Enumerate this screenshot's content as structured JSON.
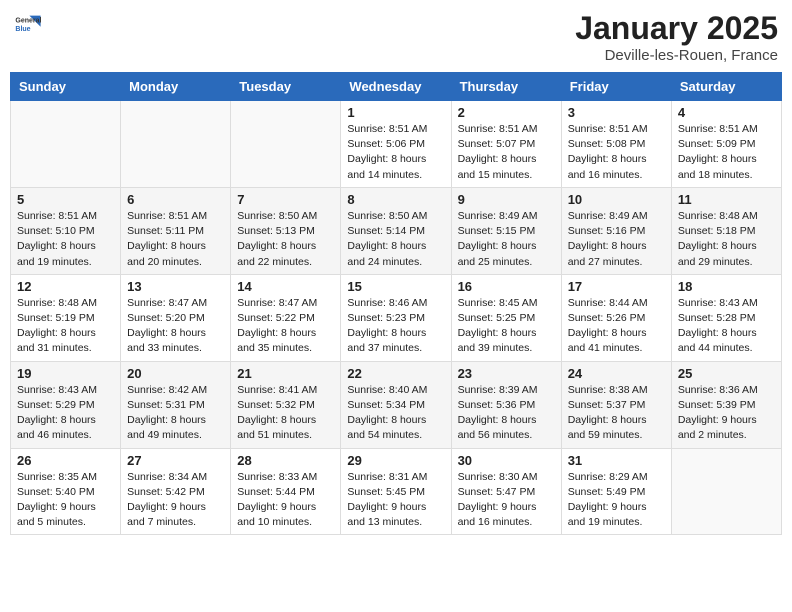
{
  "header": {
    "logo_general": "General",
    "logo_blue": "Blue",
    "month": "January 2025",
    "location": "Deville-les-Rouen, France"
  },
  "weekdays": [
    "Sunday",
    "Monday",
    "Tuesday",
    "Wednesday",
    "Thursday",
    "Friday",
    "Saturday"
  ],
  "weeks": [
    [
      {
        "day": "",
        "info": ""
      },
      {
        "day": "",
        "info": ""
      },
      {
        "day": "",
        "info": ""
      },
      {
        "day": "1",
        "info": "Sunrise: 8:51 AM\nSunset: 5:06 PM\nDaylight: 8 hours\nand 14 minutes."
      },
      {
        "day": "2",
        "info": "Sunrise: 8:51 AM\nSunset: 5:07 PM\nDaylight: 8 hours\nand 15 minutes."
      },
      {
        "day": "3",
        "info": "Sunrise: 8:51 AM\nSunset: 5:08 PM\nDaylight: 8 hours\nand 16 minutes."
      },
      {
        "day": "4",
        "info": "Sunrise: 8:51 AM\nSunset: 5:09 PM\nDaylight: 8 hours\nand 18 minutes."
      }
    ],
    [
      {
        "day": "5",
        "info": "Sunrise: 8:51 AM\nSunset: 5:10 PM\nDaylight: 8 hours\nand 19 minutes."
      },
      {
        "day": "6",
        "info": "Sunrise: 8:51 AM\nSunset: 5:11 PM\nDaylight: 8 hours\nand 20 minutes."
      },
      {
        "day": "7",
        "info": "Sunrise: 8:50 AM\nSunset: 5:13 PM\nDaylight: 8 hours\nand 22 minutes."
      },
      {
        "day": "8",
        "info": "Sunrise: 8:50 AM\nSunset: 5:14 PM\nDaylight: 8 hours\nand 24 minutes."
      },
      {
        "day": "9",
        "info": "Sunrise: 8:49 AM\nSunset: 5:15 PM\nDaylight: 8 hours\nand 25 minutes."
      },
      {
        "day": "10",
        "info": "Sunrise: 8:49 AM\nSunset: 5:16 PM\nDaylight: 8 hours\nand 27 minutes."
      },
      {
        "day": "11",
        "info": "Sunrise: 8:48 AM\nSunset: 5:18 PM\nDaylight: 8 hours\nand 29 minutes."
      }
    ],
    [
      {
        "day": "12",
        "info": "Sunrise: 8:48 AM\nSunset: 5:19 PM\nDaylight: 8 hours\nand 31 minutes."
      },
      {
        "day": "13",
        "info": "Sunrise: 8:47 AM\nSunset: 5:20 PM\nDaylight: 8 hours\nand 33 minutes."
      },
      {
        "day": "14",
        "info": "Sunrise: 8:47 AM\nSunset: 5:22 PM\nDaylight: 8 hours\nand 35 minutes."
      },
      {
        "day": "15",
        "info": "Sunrise: 8:46 AM\nSunset: 5:23 PM\nDaylight: 8 hours\nand 37 minutes."
      },
      {
        "day": "16",
        "info": "Sunrise: 8:45 AM\nSunset: 5:25 PM\nDaylight: 8 hours\nand 39 minutes."
      },
      {
        "day": "17",
        "info": "Sunrise: 8:44 AM\nSunset: 5:26 PM\nDaylight: 8 hours\nand 41 minutes."
      },
      {
        "day": "18",
        "info": "Sunrise: 8:43 AM\nSunset: 5:28 PM\nDaylight: 8 hours\nand 44 minutes."
      }
    ],
    [
      {
        "day": "19",
        "info": "Sunrise: 8:43 AM\nSunset: 5:29 PM\nDaylight: 8 hours\nand 46 minutes."
      },
      {
        "day": "20",
        "info": "Sunrise: 8:42 AM\nSunset: 5:31 PM\nDaylight: 8 hours\nand 49 minutes."
      },
      {
        "day": "21",
        "info": "Sunrise: 8:41 AM\nSunset: 5:32 PM\nDaylight: 8 hours\nand 51 minutes."
      },
      {
        "day": "22",
        "info": "Sunrise: 8:40 AM\nSunset: 5:34 PM\nDaylight: 8 hours\nand 54 minutes."
      },
      {
        "day": "23",
        "info": "Sunrise: 8:39 AM\nSunset: 5:36 PM\nDaylight: 8 hours\nand 56 minutes."
      },
      {
        "day": "24",
        "info": "Sunrise: 8:38 AM\nSunset: 5:37 PM\nDaylight: 8 hours\nand 59 minutes."
      },
      {
        "day": "25",
        "info": "Sunrise: 8:36 AM\nSunset: 5:39 PM\nDaylight: 9 hours\nand 2 minutes."
      }
    ],
    [
      {
        "day": "26",
        "info": "Sunrise: 8:35 AM\nSunset: 5:40 PM\nDaylight: 9 hours\nand 5 minutes."
      },
      {
        "day": "27",
        "info": "Sunrise: 8:34 AM\nSunset: 5:42 PM\nDaylight: 9 hours\nand 7 minutes."
      },
      {
        "day": "28",
        "info": "Sunrise: 8:33 AM\nSunset: 5:44 PM\nDaylight: 9 hours\nand 10 minutes."
      },
      {
        "day": "29",
        "info": "Sunrise: 8:31 AM\nSunset: 5:45 PM\nDaylight: 9 hours\nand 13 minutes."
      },
      {
        "day": "30",
        "info": "Sunrise: 8:30 AM\nSunset: 5:47 PM\nDaylight: 9 hours\nand 16 minutes."
      },
      {
        "day": "31",
        "info": "Sunrise: 8:29 AM\nSunset: 5:49 PM\nDaylight: 9 hours\nand 19 minutes."
      },
      {
        "day": "",
        "info": ""
      }
    ]
  ]
}
